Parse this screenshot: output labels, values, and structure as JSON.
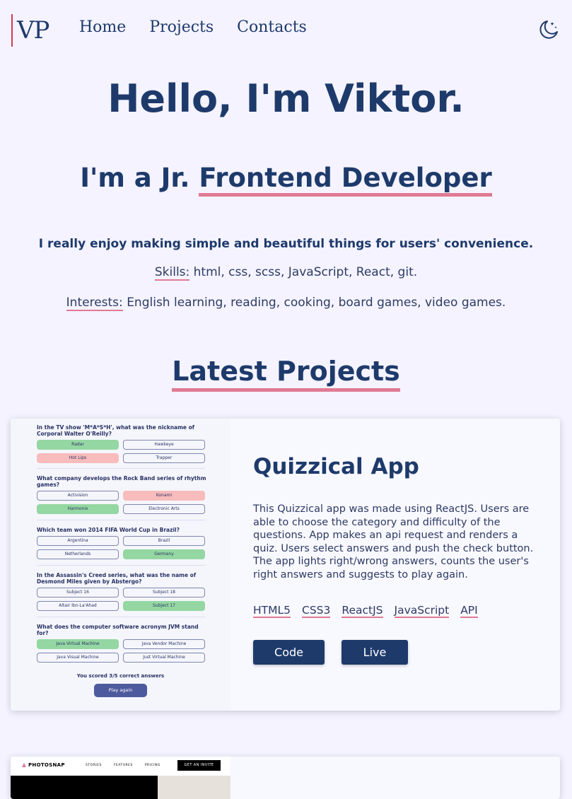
{
  "nav": {
    "logo": "VP",
    "links": [
      "Home",
      "Projects",
      "Contacts"
    ],
    "theme_icon": "moon-stars-icon"
  },
  "hero": {
    "title": "Hello, I'm Viktor.",
    "role_prefix": "I'm a Jr.",
    "role_highlight": "Frontend Developer",
    "tagline": "I really enjoy making simple and beautiful things for users' convenience.",
    "skills_label": "Skills:",
    "skills_value": "html, css, scss, JavaScript, React, git.",
    "interests_label": "Interests:",
    "interests_value": "English learning, reading, cooking, board games, video games."
  },
  "projects_section": {
    "title": "Latest Projects"
  },
  "projects": [
    {
      "title": "Quizzical App",
      "description": "This Quizzical app was made using ReactJS. Users are able to choose the category and difficulty of the questions. App makes an api request and renders a quiz. Users select answers and push the check button. The app lights right/wrong answers, counts the user's right answers and suggests to play again.",
      "tags": [
        "HTML5",
        "CSS3",
        "ReactJS",
        "JavaScript",
        "API"
      ],
      "code_label": "Code",
      "live_label": "Live",
      "screenshot": {
        "questions": [
          {
            "text": "In the TV show 'M*A*S*H', what was the nickname of Corporal Walter O'Reilly?",
            "answers": [
              [
                "Radar",
                "green"
              ],
              [
                "Hawkeye",
                ""
              ],
              [
                "Hot Lips",
                "pink"
              ],
              [
                "Trapper",
                ""
              ]
            ]
          },
          {
            "text": "What company develops the Rock Band series of rhythm games?",
            "answers": [
              [
                "Activision",
                ""
              ],
              [
                "Konami",
                "pink"
              ],
              [
                "Harmonix",
                "green"
              ],
              [
                "Electronic Arts",
                ""
              ]
            ]
          },
          {
            "text": "Which team won 2014 FIFA World Cup in Brazil?",
            "answers": [
              [
                "Argentina",
                ""
              ],
              [
                "Brazil",
                ""
              ],
              [
                "Netherlands",
                ""
              ],
              [
                "Germany",
                "green"
              ]
            ]
          },
          {
            "text": "In the Assassin's Creed series, what was the name of Desmond Miles given by Abstergo?",
            "answers": [
              [
                "Subject 16",
                ""
              ],
              [
                "Subject 18",
                ""
              ],
              [
                "Altair Ibn-La'Ahad",
                ""
              ],
              [
                "Subject 17",
                "green"
              ]
            ]
          },
          {
            "text": "What does the computer software acronym JVM stand for?",
            "answers": [
              [
                "Java Virtual Machine",
                "green"
              ],
              [
                "Java Vendor Machine",
                ""
              ],
              [
                "Java Visual Machine",
                ""
              ],
              [
                "Just Virtual Machine",
                ""
              ]
            ]
          }
        ],
        "score_text": "You scored 3/5 correct answers",
        "play_again": "Play again"
      }
    },
    {
      "screenshot": {
        "logo": "PHOTOSNAP",
        "menu": [
          "STORIES",
          "FEATURES",
          "PRICING"
        ],
        "cta": "GET AN INVITE"
      }
    }
  ],
  "colors": {
    "background": "#f4f3ff",
    "primary": "#1e3a6b",
    "accent_underline": "#e07a93",
    "correct": "#94d7a2",
    "wrong": "#f8bcbc"
  }
}
